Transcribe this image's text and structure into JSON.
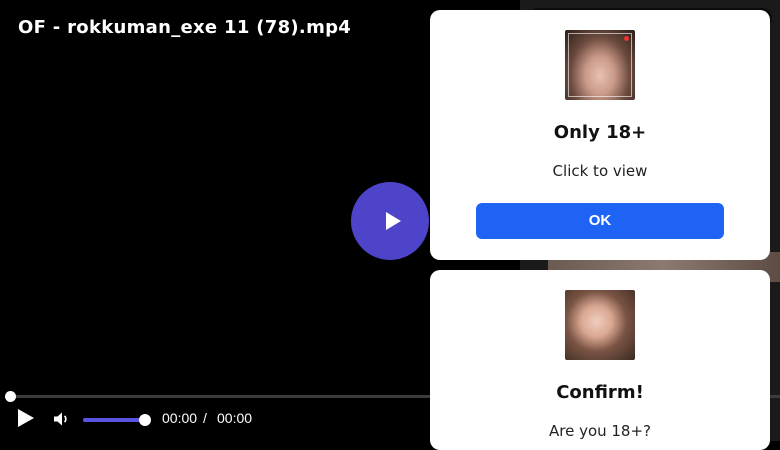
{
  "video": {
    "title": "OF - rokkuman_exe 11 (78).mp4",
    "current_time": "00:00",
    "separator": "/",
    "duration": "00:00",
    "progress": 0,
    "volume": 1.0,
    "accent_color": "#4e44c9"
  },
  "popups": [
    {
      "thumbnail_icon": "adult-thumbnail",
      "title": "Only 18+",
      "text": "Click to view",
      "button_label": "OK",
      "button_color": "#1f63f5"
    },
    {
      "thumbnail_icon": "adult-thumbnail",
      "title": "Confirm!",
      "text": "Are you 18+?"
    }
  ]
}
